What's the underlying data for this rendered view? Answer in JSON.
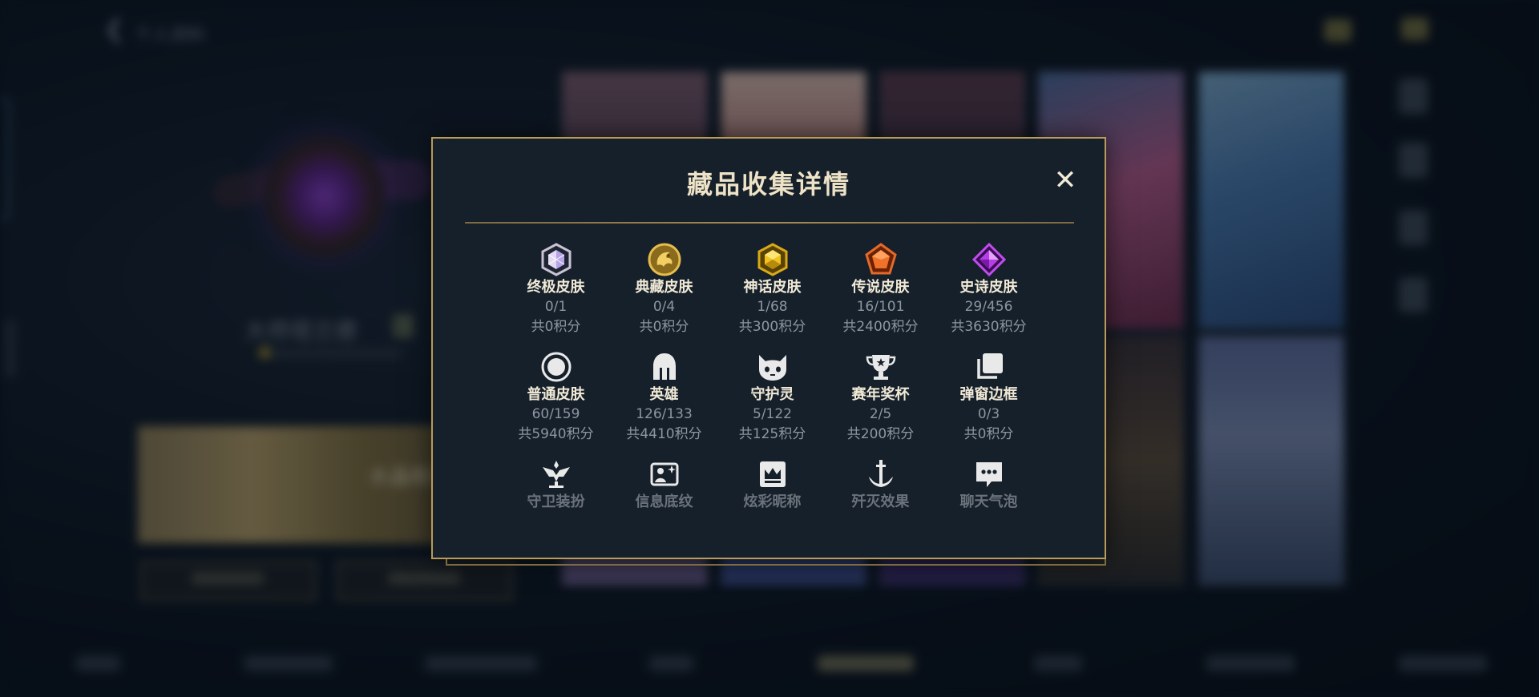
{
  "background": {
    "back_title": "个人资料",
    "player_name": "大师塔兰德",
    "banner_text": "水晶枢纽"
  },
  "modal": {
    "title": "藏品收集详情",
    "close_label": "✕",
    "rows": [
      [
        {
          "name": "终极皮肤",
          "count": "0/1",
          "points": "共0积分",
          "icon": "ultimate-gem-icon"
        },
        {
          "name": "典藏皮肤",
          "count": "0/4",
          "points": "共0积分",
          "icon": "prestige-dragon-icon"
        },
        {
          "name": "神话皮肤",
          "count": "1/68",
          "points": "共300积分",
          "icon": "mythic-gem-icon"
        },
        {
          "name": "传说皮肤",
          "count": "16/101",
          "points": "共2400积分",
          "icon": "legendary-gem-icon"
        },
        {
          "name": "史诗皮肤",
          "count": "29/456",
          "points": "共3630积分",
          "icon": "epic-gem-icon"
        }
      ],
      [
        {
          "name": "普通皮肤",
          "count": "60/159",
          "points": "共5940积分",
          "icon": "circle-icon"
        },
        {
          "name": "英雄",
          "count": "126/133",
          "points": "共4410积分",
          "icon": "helmet-icon"
        },
        {
          "name": "守护灵",
          "count": "5/122",
          "points": "共125积分",
          "icon": "guardian-face-icon"
        },
        {
          "name": "赛年奖杯",
          "count": "2/5",
          "points": "共200积分",
          "icon": "trophy-icon"
        },
        {
          "name": "弹窗边框",
          "count": "0/3",
          "points": "共0积分",
          "icon": "frame-stack-icon"
        }
      ],
      [
        {
          "name": "守卫装扮",
          "icon": "ward-icon"
        },
        {
          "name": "信息底纹",
          "icon": "banner-image-icon"
        },
        {
          "name": "炫彩昵称",
          "icon": "crown-card-icon"
        },
        {
          "name": "歼灭效果",
          "icon": "anchor-sword-icon"
        },
        {
          "name": "聊天气泡",
          "icon": "chat-bubble-icon"
        }
      ]
    ]
  },
  "colors": {
    "modal_bg": "#16202b",
    "gold_border": "#b99b5a",
    "title_text": "#eee3c6",
    "muted_text": "#8d96a0"
  }
}
